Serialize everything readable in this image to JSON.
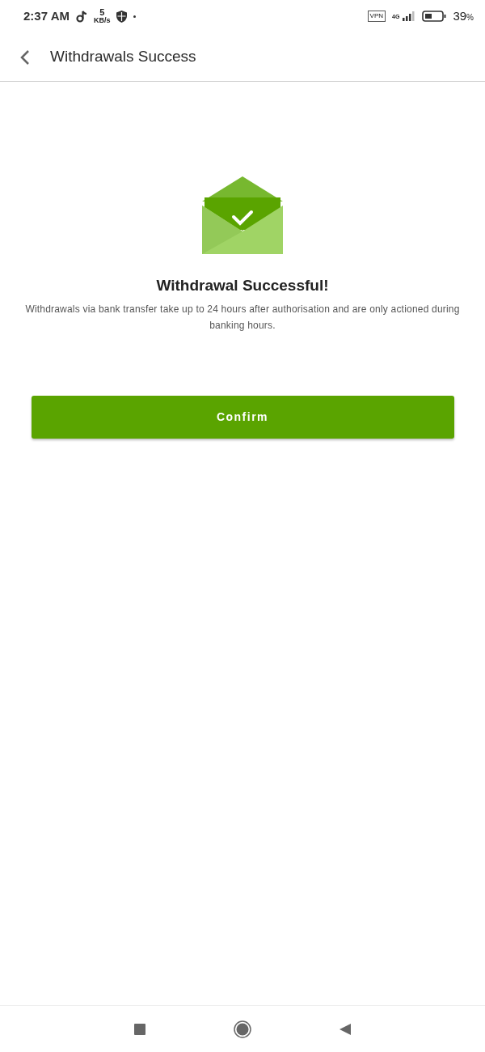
{
  "status_bar": {
    "time": "2:37 AM",
    "net_speed": "5",
    "net_unit": "KB/s",
    "vpn": "VPN",
    "network": "4G",
    "battery": "39",
    "battery_unit": "%"
  },
  "header": {
    "title": "Withdrawals Success"
  },
  "message": {
    "title": "Withdrawal Successful!",
    "text": "Withdrawals via bank transfer take up to 24 hours after authorisation and are only actioned during banking hours."
  },
  "buttons": [
    "Confirm"
  ]
}
